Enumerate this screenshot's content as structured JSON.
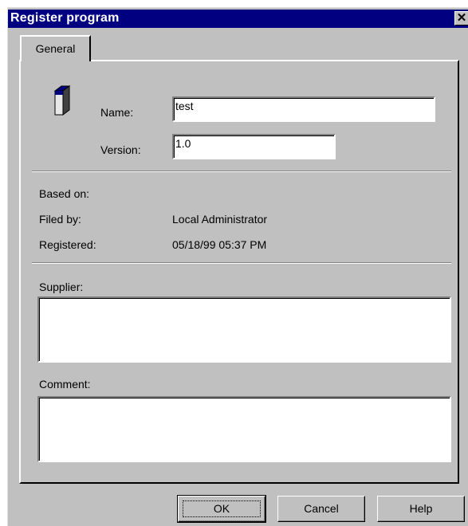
{
  "window": {
    "title": "Register program",
    "close_glyph": "✕"
  },
  "tabs": [
    {
      "label": "General"
    }
  ],
  "icon": {
    "name": "program-package-icon"
  },
  "fields": {
    "name_label": "Name:",
    "name_value": "test",
    "version_label": "Version:",
    "version_value": "1.0"
  },
  "info": {
    "based_on_label": "Based on:",
    "based_on_value": "",
    "filed_by_label": "Filed by:",
    "filed_by_value": "Local Administrator",
    "registered_label": "Registered:",
    "registered_value": "05/18/99 05:37 PM"
  },
  "supplier": {
    "label": "Supplier:",
    "value": ""
  },
  "comment": {
    "label": "Comment:",
    "value": ""
  },
  "buttons": {
    "ok": "OK",
    "cancel": "Cancel",
    "help": "Help"
  }
}
